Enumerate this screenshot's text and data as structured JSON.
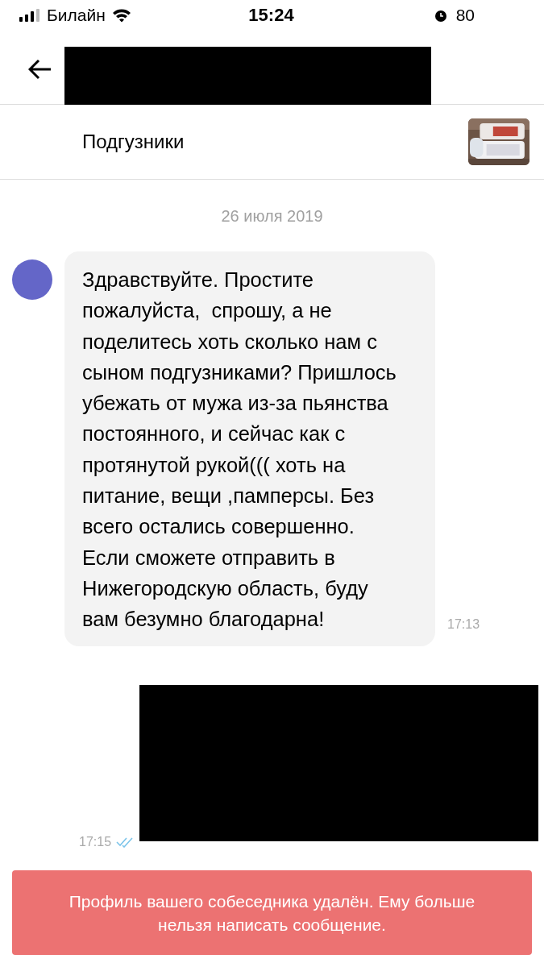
{
  "status_bar": {
    "carrier": "Билайн",
    "time": "15:24",
    "battery": "80"
  },
  "listing": {
    "title": "Подгузники"
  },
  "date": "26 июля 2019",
  "messages": [
    {
      "kind": "incoming",
      "text": "Здравствуйте. Простите пожалуйста,  спрошу, а не поделитесь хоть сколько нам с сыном подгузниками? Пришлось убежать от мужа из-за пьянства постоянного, и сейчас как с протянутой рукой((( хоть на питание, вещи ,памперсы. Без всего остались совершенно. Если сможете отправить в Нижегородскую область, буду вам безумно благодарна!",
      "time": "17:13"
    },
    {
      "kind": "outgoing",
      "time": "17:15",
      "read": true
    }
  ],
  "toast": "Профиль вашего собеседника удалён. Ему больше нельзя написать сообщение."
}
